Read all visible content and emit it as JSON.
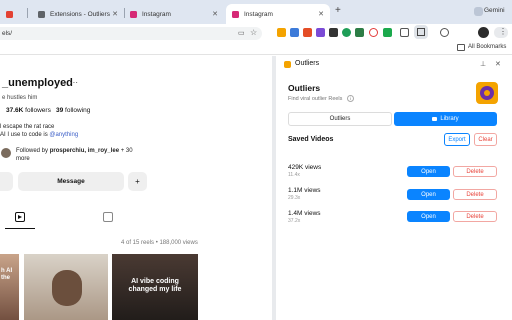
{
  "tabs": [
    {
      "label": "",
      "icon": "gmail-icon",
      "color": "#e34133"
    },
    {
      "label": "Extensions - Outliers",
      "icon": "puzzle-icon",
      "color": "#5f6368"
    },
    {
      "label": "Instagram",
      "icon": "instagram-icon",
      "color": "#d62976"
    },
    {
      "label": "Instagram",
      "icon": "instagram-icon",
      "color": "#d62976",
      "active": true
    }
  ],
  "new_tab_symbol": "+",
  "gemini_label": "Gemini",
  "address": "els/",
  "all_bookmarks_label": "All Bookmarks",
  "ig": {
    "username": "_unemployed",
    "more": "···",
    "bio_top": "e hustles him",
    "followers_count": "37.6K",
    "followers_label": "followers",
    "following_count": "39",
    "following_label": "following",
    "bio_line1": "l escape the rat race",
    "bio_line2_prefix": "AI I use to code is",
    "bio_line2_link": "@anything",
    "followed_by_prefix": "Followed by",
    "followed_by_names": "prosperchiu, im_roy_lee",
    "followed_by_suffix": "+ 30",
    "followed_by_more": "more",
    "message_label": "Message",
    "reels_count": "4 of 15 reels • 188,000 views",
    "reel_captions": [
      "h AI\nthe",
      "",
      "AI vibe coding\nchanged my life"
    ]
  },
  "panel": {
    "header_title": "Outliers",
    "title": "Outliers",
    "subtitle": "Find viral outlier Reels",
    "info_glyph": "i",
    "tab_outliers": "Outliers",
    "tab_library": "Library",
    "saved_title": "Saved Videos",
    "export_label": "Export",
    "clear_label": "Clear",
    "open_label": "Open",
    "delete_label": "Delete",
    "videos": [
      {
        "views": "429K views",
        "multiplier": "11.4x"
      },
      {
        "views": "1.1M views",
        "multiplier": "29.3x"
      },
      {
        "views": "1.4M views",
        "multiplier": "37.2x"
      }
    ]
  },
  "colors": {
    "accent": "#0a84ff",
    "danger": "#e8433a",
    "tabstrip": "#dfe6f1"
  }
}
